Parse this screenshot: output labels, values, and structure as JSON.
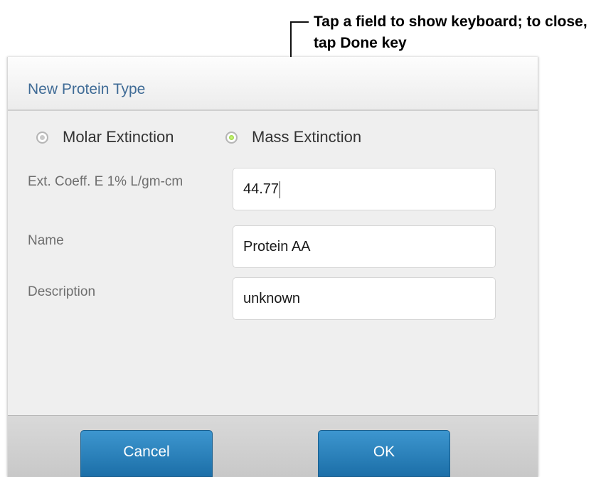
{
  "annotation": {
    "text": "Tap a field to show keyboard; to close, tap Done key"
  },
  "dialog": {
    "title": "New Protein Type",
    "radios": [
      {
        "label": "Molar Extinction",
        "selected": false
      },
      {
        "label": "Mass Extinction",
        "selected": true
      }
    ],
    "fields": {
      "ext_coeff": {
        "label": "Ext. Coeff. E 1% L/gm-cm",
        "value": "44.77"
      },
      "name": {
        "label": "Name",
        "value": "Protein AA"
      },
      "description": {
        "label": "Description",
        "value": "unknown"
      }
    },
    "buttons": {
      "cancel": "Cancel",
      "ok": "OK"
    }
  },
  "colors": {
    "title": "#3f6b96",
    "button": "#2a82bd",
    "radio_selected": "#79c21a"
  }
}
